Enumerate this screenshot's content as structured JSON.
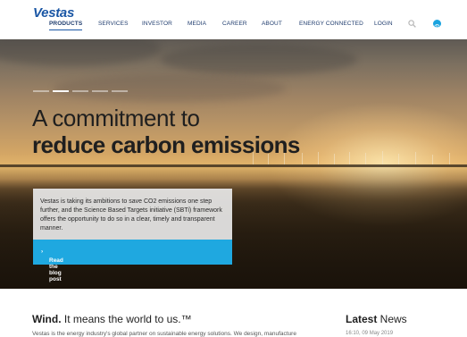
{
  "header": {
    "logo_text": "Vestas",
    "nav": [
      "PRODUCTS",
      "SERVICES",
      "INVESTOR",
      "MEDIA",
      "CAREER",
      "ABOUT",
      "ENERGY CONNECTED",
      "LOGIN"
    ],
    "active_nav": "PRODUCTS",
    "icons": [
      "search-icon",
      "globe-icon"
    ]
  },
  "hero": {
    "title_line1": "A commitment to",
    "title_line2": "reduce carbon emissions",
    "card_text": "Vestas is taking its ambitions to save CO2 emissions one step further, and the Science Based Targets initiative (SBTi) framework offers the opportunity to do so in a clear, timely and transparent manner.",
    "cta_label": "Read the blog post",
    "slide_count": 5,
    "active_slide": 2
  },
  "intro": {
    "tagline_bold": "Wind.",
    "tagline_rest": " It means the world to us.™",
    "body_text": "Vestas is the energy industry's global partner on sustainable energy solutions. We design, manufacture"
  },
  "news": {
    "title_bold": "Latest",
    "title_rest": " News",
    "date": "16:10, 09 May 2019"
  },
  "colors": {
    "brand_blue": "#1b57a5",
    "cta_blue": "#1fa8e0"
  }
}
